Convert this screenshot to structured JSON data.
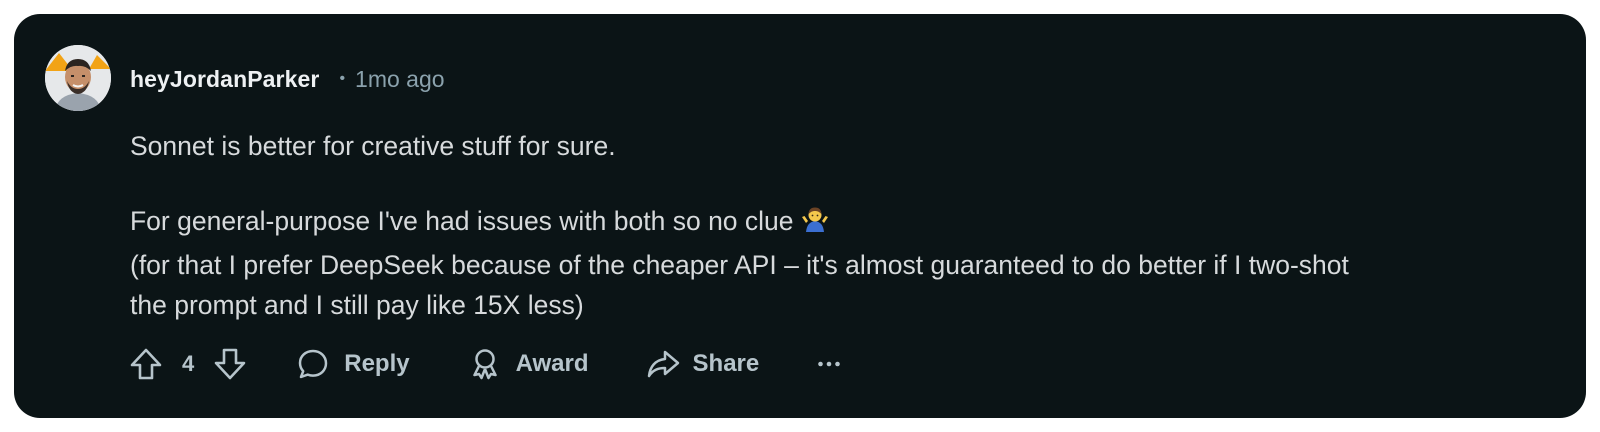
{
  "comment": {
    "author": "heyJordanParker",
    "separator": "•",
    "time_ago": "1mo ago",
    "body": {
      "paragraph1": "Sonnet is better for creative stuff for sure.",
      "line2": "For general-purpose I've had issues with both so no clue",
      "line2_emoji": "person-shrugging-emoji",
      "line3": "(for that I prefer DeepSeek because of the cheaper API – it's almost guaranteed to do better if I two-shot",
      "line4": "the prompt and I still pay like 15X less)"
    }
  },
  "actions": {
    "vote_count": "4",
    "reply_label": "Reply",
    "award_label": "Award",
    "share_label": "Share",
    "more_label": "•••"
  },
  "icons": {
    "upvote": "upvote-arrow-icon",
    "downvote": "downvote-arrow-icon",
    "reply": "speech-bubble-icon",
    "award": "award-ribbon-icon",
    "share": "share-arrow-icon",
    "more": "ellipsis-icon"
  },
  "colors": {
    "card_background": "#0b1416",
    "text_primary": "#eef1f3",
    "text_body": "#d7dadc",
    "text_muted": "#8ba2ad",
    "action_color": "#b6c4cb"
  }
}
